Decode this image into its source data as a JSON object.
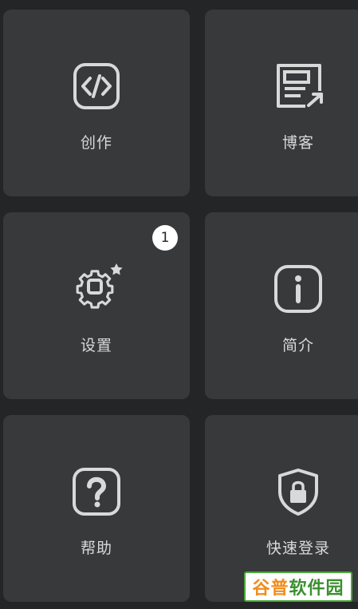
{
  "tiles": [
    {
      "label": "创作",
      "icon": "code-icon"
    },
    {
      "label": "博客",
      "icon": "blog-icon"
    },
    {
      "label": "设置",
      "icon": "settings-icon",
      "badge": "1"
    },
    {
      "label": "简介",
      "icon": "info-icon"
    },
    {
      "label": "帮助",
      "icon": "help-icon"
    },
    {
      "label": "快速登录",
      "icon": "shield-lock-icon"
    }
  ],
  "watermark": {
    "part1": "谷普",
    "part2": "软件园"
  },
  "colors": {
    "background": "#242527",
    "tile": "#38393b",
    "icon": "#d9d9d9",
    "badge": "#ffffff"
  }
}
